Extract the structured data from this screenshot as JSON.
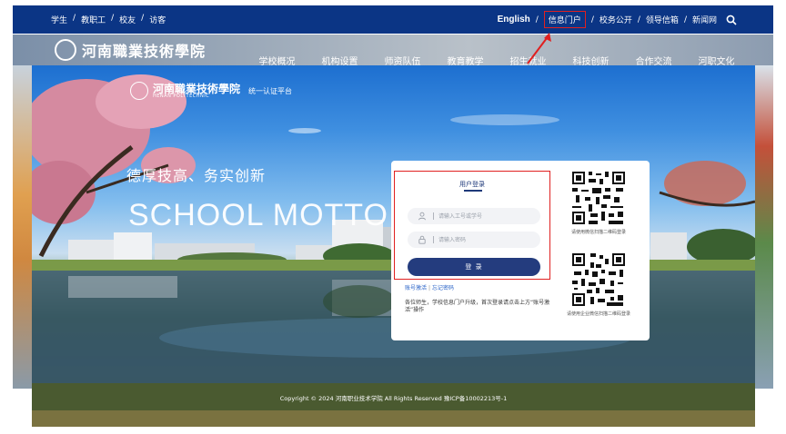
{
  "topbar": {
    "left_links": [
      "学生",
      "教职工",
      "校友",
      "访客"
    ],
    "english": "English",
    "right_links": [
      "信息门户",
      "校务公开",
      "领导信箱",
      "新闻网"
    ],
    "separator": "/"
  },
  "site": {
    "name": "河南職業技術學院",
    "nav": [
      "学校概况",
      "机构设置",
      "师资队伍",
      "教育教学",
      "招生就业",
      "科技创新",
      "合作交流",
      "河职文化"
    ]
  },
  "overlay": {
    "logo_cn": "河南職業技術學院",
    "logo_en": "HENAN POLYTECHNIC",
    "platform": "统一认证平台",
    "motto_cn": "德厚技高、务实创新",
    "motto_en": "SCHOOL MOTTO",
    "copyright": "Copyright © 2024 河南职业技术学院 All Rights Reserved 豫ICP备10002213号-1"
  },
  "login": {
    "title": "用户登录",
    "username_placeholder": "请输入工号或学号",
    "password_placeholder": "请输入密码",
    "button": "登 录",
    "activate_link": "账号激活",
    "forgot_link": "忘记密码",
    "link_separator": "|",
    "notice": "各位师生，学校信息门户升级，首次登录请点击上方“账号激活”操作"
  },
  "qr": {
    "scan_caption": "请使用微信扫描二维码登录",
    "wework_caption": "请使用企业微信扫描二维码登录"
  },
  "colors": {
    "topbar_bg": "#0b3585",
    "highlight_red": "#e02020",
    "button_bg": "#243c7e",
    "link_blue": "#2a63c7"
  }
}
